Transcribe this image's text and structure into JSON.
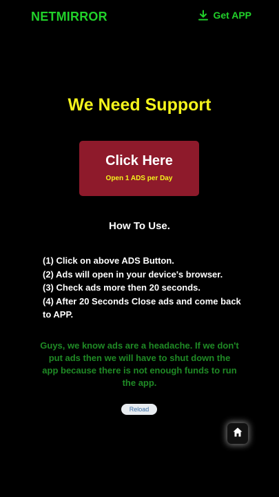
{
  "header": {
    "brand": "NETMIRROR",
    "get_app_label": "Get APP",
    "get_app_icon": "download-icon"
  },
  "colors": {
    "brand_green": "#21d12a",
    "headline_yellow": "#f5f51c",
    "button_red": "#8e1a2b",
    "note_green": "#1f8a25",
    "background": "#000000"
  },
  "main": {
    "headline": "We Need Support",
    "ads_button": {
      "title": "Click Here",
      "subtitle": "Open 1 ADS per Day"
    },
    "howto_title": "How To Use.",
    "steps": [
      "(1) Click on above ADS Button.",
      "(2) Ads will open in your device's browser.",
      "(3) Check ads more then 20 seconds.",
      "(4) After 20 Seconds Close ads and come back to APP."
    ],
    "note": "Guys, we know ads are a headache. If we don't put ads then we will have to shut down the app because there is not enough funds to run the app.",
    "reload_label": "Reload"
  },
  "floating": {
    "home_icon": "home-icon"
  }
}
